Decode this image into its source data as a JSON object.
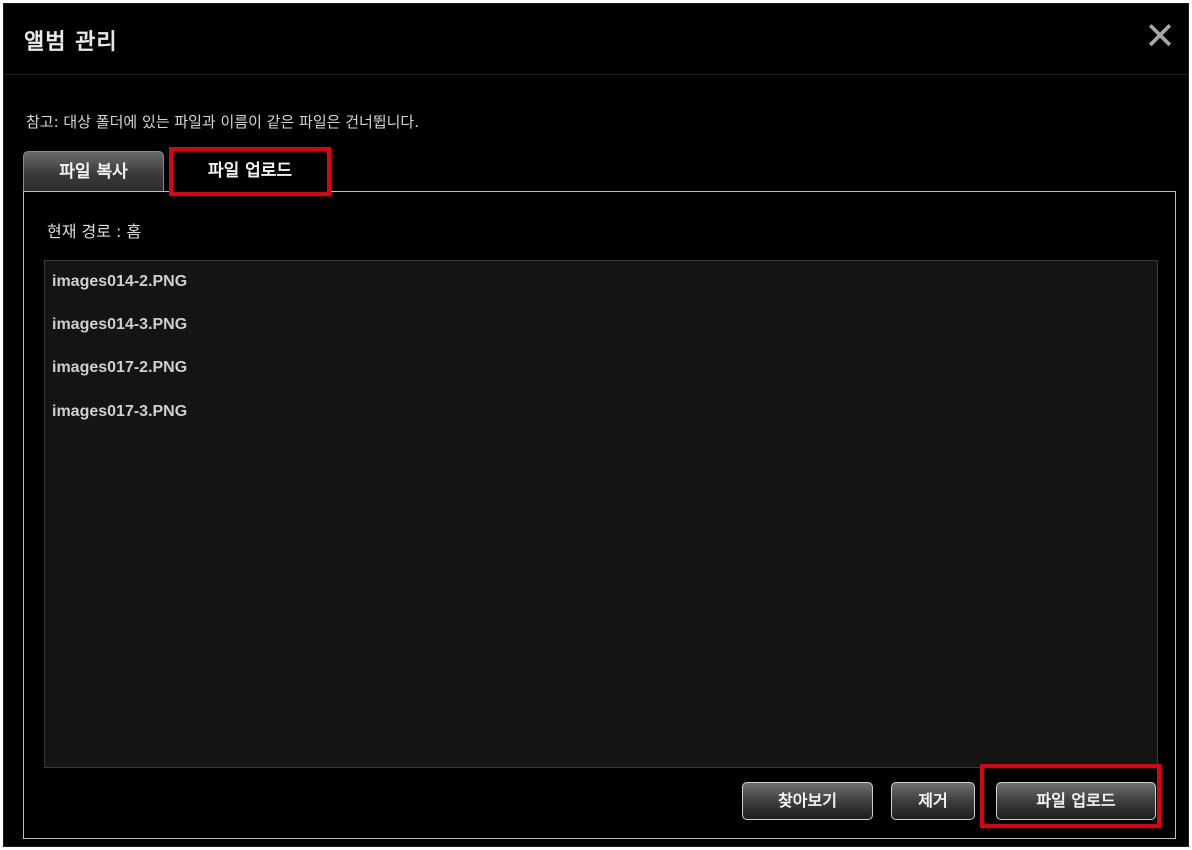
{
  "dialog": {
    "title": "앨범 관리",
    "close_icon": "close-icon",
    "note": "참고: 대상 폴더에 있는 파일과 이름이 같은 파일은 건너뜁니다."
  },
  "tabs": [
    {
      "label": "파일 복사",
      "active": false
    },
    {
      "label": "파일 업로드",
      "active": true
    }
  ],
  "panel": {
    "current_path": "현재 경로 : 홈",
    "files": [
      "images014-2.PNG",
      "images014-3.PNG",
      "images017-2.PNG",
      "images017-3.PNG"
    ]
  },
  "buttons": {
    "browse": "찾아보기",
    "remove": "제거",
    "upload": "파일 업로드"
  },
  "colors": {
    "highlight": "#e0000f",
    "background": "#000000"
  }
}
